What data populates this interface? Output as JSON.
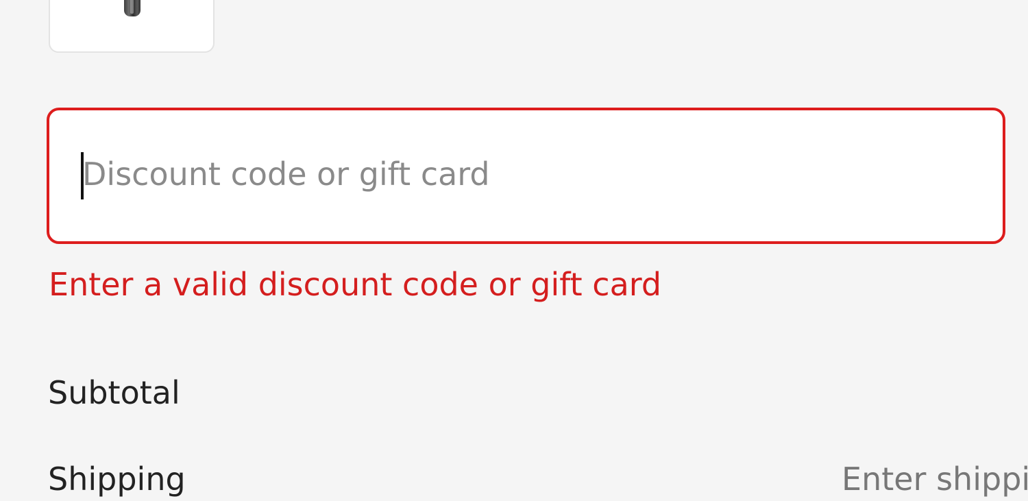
{
  "discount": {
    "placeholder": "Discount code or gift card",
    "value": "",
    "error": "Enter a valid discount code or gift card"
  },
  "summary": {
    "subtotal_label": "Subtotal",
    "shipping_label": "Shipping",
    "shipping_value": "Enter shippi"
  },
  "colors": {
    "error": "#dd1d1d",
    "background": "#f5f5f5"
  }
}
